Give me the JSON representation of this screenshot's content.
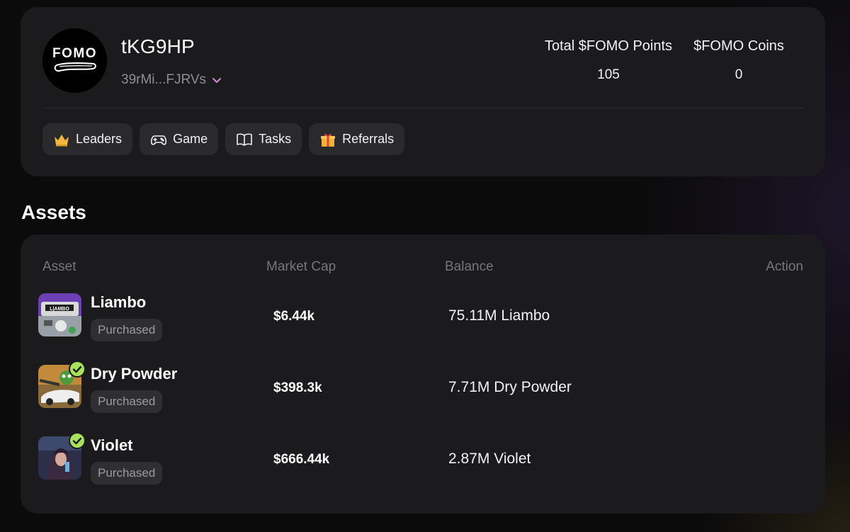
{
  "profile": {
    "logo_text": "FOMO",
    "username": "tKG9HP",
    "wallet_short": "39rMi...FJRVs",
    "stats": [
      {
        "label": "Total $FOMO Points",
        "value": "105"
      },
      {
        "label": "$FOMO Coins",
        "value": "0"
      }
    ]
  },
  "nav": [
    {
      "label": "Leaders",
      "icon": "crown-icon"
    },
    {
      "label": "Game",
      "icon": "gamepad-icon"
    },
    {
      "label": "Tasks",
      "icon": "book-icon"
    },
    {
      "label": "Referrals",
      "icon": "gift-icon"
    }
  ],
  "assets": {
    "title": "Assets",
    "headers": {
      "asset": "Asset",
      "market_cap": "Market Cap",
      "balance": "Balance",
      "action": "Action"
    },
    "rows": [
      {
        "name": "Liambo",
        "badge": "Purchased",
        "market_cap": "$6.44k",
        "balance": "75.11M Liambo",
        "verified": false
      },
      {
        "name": "Dry Powder",
        "badge": "Purchased",
        "market_cap": "$398.3k",
        "balance": "7.71M Dry Powder",
        "verified": true
      },
      {
        "name": "Violet",
        "badge": "Purchased",
        "market_cap": "$666.44k",
        "balance": "2.87M Violet",
        "verified": true
      }
    ]
  },
  "colors": {
    "accent_chevron": "#d98ad4",
    "verified": "#a7e25a",
    "card": "#1b1b1d"
  }
}
